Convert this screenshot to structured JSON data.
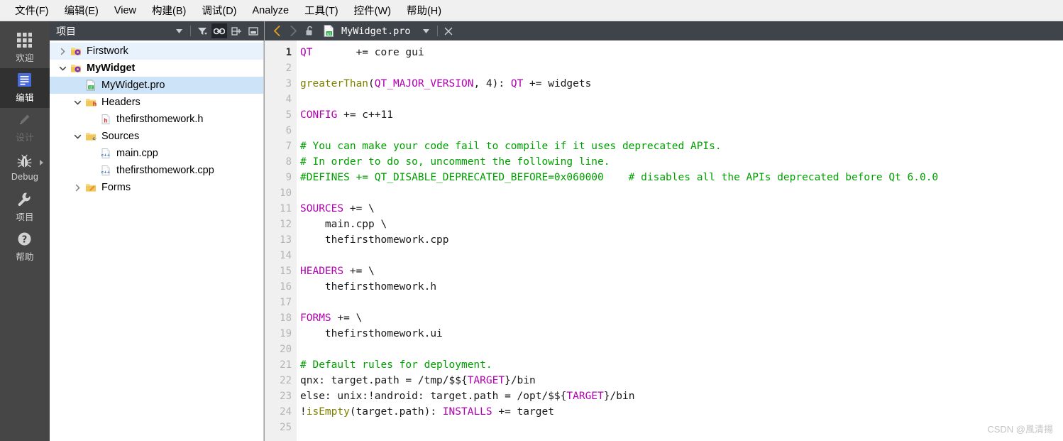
{
  "menubar": {
    "items": [
      {
        "label": "文件(F)"
      },
      {
        "label": "编辑(E)"
      },
      {
        "label": "View"
      },
      {
        "label": "构建(B)"
      },
      {
        "label": "调试(D)"
      },
      {
        "label": "Analyze"
      },
      {
        "label": "工具(T)"
      },
      {
        "label": "控件(W)"
      },
      {
        "label": "帮助(H)"
      }
    ]
  },
  "modebar": {
    "items": [
      {
        "label": "欢迎",
        "icon": "grid-icon",
        "state": "normal"
      },
      {
        "label": "编辑",
        "icon": "document-icon",
        "state": "selected"
      },
      {
        "label": "设计",
        "icon": "pencil-icon",
        "state": "disabled"
      },
      {
        "label": "Debug",
        "icon": "bug-icon",
        "state": "normal"
      },
      {
        "label": "项目",
        "icon": "wrench-icon",
        "state": "normal"
      },
      {
        "label": "帮助",
        "icon": "question-icon",
        "state": "normal"
      }
    ]
  },
  "project_panel": {
    "title": "项目",
    "toolbar": [
      {
        "name": "dropdown-icon",
        "active": false
      },
      {
        "name": "filter-icon",
        "active": false
      },
      {
        "name": "link-icon",
        "active": true
      },
      {
        "name": "split-add-icon",
        "active": false
      },
      {
        "name": "minimize-icon",
        "active": false
      }
    ],
    "tree": [
      {
        "label": "Firstwork",
        "icon": "qt-project-icon",
        "indent": 0,
        "chevron": "right",
        "state": "hover",
        "bold": false
      },
      {
        "label": "MyWidget",
        "icon": "qt-project-icon",
        "indent": 0,
        "chevron": "down",
        "state": "none",
        "bold": true
      },
      {
        "label": "MyWidget.pro",
        "icon": "pro-file-icon",
        "indent": 1,
        "chevron": "none",
        "state": "selected",
        "bold": false
      },
      {
        "label": "Headers",
        "icon": "headers-folder-icon",
        "indent": 1,
        "chevron": "down",
        "state": "none",
        "bold": false
      },
      {
        "label": "thefirsthomework.h",
        "icon": "h-file-icon",
        "indent": 2,
        "chevron": "none",
        "state": "none",
        "bold": false
      },
      {
        "label": "Sources",
        "icon": "sources-folder-icon",
        "indent": 1,
        "chevron": "down",
        "state": "none",
        "bold": false
      },
      {
        "label": "main.cpp",
        "icon": "cpp-file-icon",
        "indent": 2,
        "chevron": "none",
        "state": "none",
        "bold": false
      },
      {
        "label": "thefirsthomework.cpp",
        "icon": "cpp-file-icon",
        "indent": 2,
        "chevron": "none",
        "state": "none",
        "bold": false
      },
      {
        "label": "Forms",
        "icon": "forms-folder-icon",
        "indent": 1,
        "chevron": "right",
        "state": "none",
        "bold": false
      }
    ]
  },
  "editor": {
    "tab": {
      "filename": "MyWidget.pro",
      "back_enabled": true,
      "forward_enabled": false,
      "lock_state": "unlocked"
    },
    "current_line": 1,
    "total_lines": 25,
    "lines": [
      {
        "n": 1,
        "tokens": [
          {
            "t": "QT",
            "c": "v"
          },
          {
            "t": "       += core gui",
            "c": "p"
          }
        ]
      },
      {
        "n": 2,
        "tokens": []
      },
      {
        "n": 3,
        "tokens": [
          {
            "t": "greaterThan",
            "c": "f"
          },
          {
            "t": "(",
            "c": "p"
          },
          {
            "t": "QT_MAJOR_VERSION",
            "c": "v"
          },
          {
            "t": ", 4): ",
            "c": "p"
          },
          {
            "t": "QT",
            "c": "v"
          },
          {
            "t": " += widgets",
            "c": "p"
          }
        ]
      },
      {
        "n": 4,
        "tokens": []
      },
      {
        "n": 5,
        "tokens": [
          {
            "t": "CONFIG",
            "c": "v"
          },
          {
            "t": " += c++11",
            "c": "p"
          }
        ]
      },
      {
        "n": 6,
        "tokens": []
      },
      {
        "n": 7,
        "tokens": [
          {
            "t": "# You can make your code fail to compile if it uses deprecated APIs.",
            "c": "c"
          }
        ]
      },
      {
        "n": 8,
        "tokens": [
          {
            "t": "# In order to do so, uncomment the following line.",
            "c": "c"
          }
        ]
      },
      {
        "n": 9,
        "tokens": [
          {
            "t": "#DEFINES += QT_DISABLE_DEPRECATED_BEFORE=0x060000    # disables all the APIs deprecated before Qt 6.0.0",
            "c": "c"
          }
        ]
      },
      {
        "n": 10,
        "tokens": []
      },
      {
        "n": 11,
        "tokens": [
          {
            "t": "SOURCES",
            "c": "v"
          },
          {
            "t": " += \\",
            "c": "p"
          }
        ]
      },
      {
        "n": 12,
        "tokens": [
          {
            "t": "    main.cpp \\",
            "c": "p"
          }
        ]
      },
      {
        "n": 13,
        "tokens": [
          {
            "t": "    thefirsthomework.cpp",
            "c": "p"
          }
        ]
      },
      {
        "n": 14,
        "tokens": []
      },
      {
        "n": 15,
        "tokens": [
          {
            "t": "HEADERS",
            "c": "v"
          },
          {
            "t": " += \\",
            "c": "p"
          }
        ]
      },
      {
        "n": 16,
        "tokens": [
          {
            "t": "    thefirsthomework.h",
            "c": "p"
          }
        ]
      },
      {
        "n": 17,
        "tokens": []
      },
      {
        "n": 18,
        "tokens": [
          {
            "t": "FORMS",
            "c": "v"
          },
          {
            "t": " += \\",
            "c": "p"
          }
        ]
      },
      {
        "n": 19,
        "tokens": [
          {
            "t": "    thefirsthomework.ui",
            "c": "p"
          }
        ]
      },
      {
        "n": 20,
        "tokens": []
      },
      {
        "n": 21,
        "tokens": [
          {
            "t": "# Default rules for deployment.",
            "c": "c"
          }
        ]
      },
      {
        "n": 22,
        "tokens": [
          {
            "t": "qnx: target.path = /tmp/$${",
            "c": "p"
          },
          {
            "t": "TARGET",
            "c": "v"
          },
          {
            "t": "}/bin",
            "c": "p"
          }
        ]
      },
      {
        "n": 23,
        "tokens": [
          {
            "t": "else: unix:!android: target.path = /opt/$${",
            "c": "p"
          },
          {
            "t": "TARGET",
            "c": "v"
          },
          {
            "t": "}/bin",
            "c": "p"
          }
        ]
      },
      {
        "n": 24,
        "tokens": [
          {
            "t": "!",
            "c": "p"
          },
          {
            "t": "isEmpty",
            "c": "f"
          },
          {
            "t": "(target.path): ",
            "c": "p"
          },
          {
            "t": "INSTALLS",
            "c": "v"
          },
          {
            "t": " += target",
            "c": "p"
          }
        ]
      },
      {
        "n": 25,
        "tokens": []
      }
    ]
  },
  "watermark": {
    "text": "CSDN @風清揚"
  },
  "colors": {
    "menubar_bg": "#f0f0f0",
    "modebar_bg": "#464646",
    "panel_header_bg": "#3f444a",
    "selection_blue": "#cde3f7",
    "hover_blue": "#e8f2fc",
    "comment_green": "#00a000",
    "variable_purple": "#b000b0",
    "function_olive": "#808000"
  }
}
